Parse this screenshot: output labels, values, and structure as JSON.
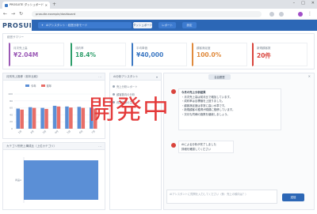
{
  "browser": {
    "tab_title": "PROSUITE ダッシュボード",
    "url": "prosuite.example/dashboard"
  },
  "app": {
    "logo": "PROSUITE",
    "mode_label": "AIアシスタント・経営分析モード",
    "buttons": {
      "primary": "ダッシュボード",
      "secondary": "レポート",
      "menu": "設定"
    }
  },
  "summary": {
    "title": "経営サマリー",
    "kpis": [
      {
        "label": "月次売上高",
        "value": "¥2.04M",
        "color": "#9b59b6"
      },
      {
        "label": "成約率",
        "value": "18.4%",
        "color": "#2e9e6b"
      },
      {
        "label": "平均単価",
        "value": "¥40,000",
        "color": "#3c78c3"
      },
      {
        "label": "顧客満足度",
        "value": "100.0%",
        "color": "#e08a3c"
      },
      {
        "label": "新規顧客数",
        "value": "20件",
        "color": "#d9443c"
      }
    ]
  },
  "left_top": {
    "title": "月別売上推移（前年比較）",
    "legend": [
      {
        "name": "今年",
        "color": "#5b8fd6"
      },
      {
        "name": "前年",
        "color": "#e86e68"
      }
    ]
  },
  "left_bottom": {
    "title": "カテゴリ別売上構成比（上位カテゴリ）",
    "category_label": "商品A"
  },
  "ai_panel": {
    "title": "AI分析アシスタント",
    "rows": [
      "売上分析レポート",
      "顧客動向の分析",
      "改善提案の生成"
    ]
  },
  "chat": {
    "tab": "会話履歴",
    "message_1": [
      "今月の売上分析結果",
      "・月次売上高は前月比で増加しています。",
      "・成約率は目標値を上回りました。",
      "・顧客満足度は非常に高い水準です。",
      "・新規顧客の獲得が順調に推移しています。",
      "・次月も同様の施策を継続しましょう。"
    ],
    "message_2": [
      "AIによる分析が完了しました",
      "詳細を確認してください"
    ],
    "input_placeholder": "AIアシスタントに質問を入力してください（例：売上の傾向は？）",
    "send": "送信"
  },
  "watermark": "開発中",
  "chart_data": [
    {
      "type": "bar",
      "categories": [
        "1月",
        "2月",
        "3月",
        "4月",
        "5月",
        "6月",
        "7月"
      ],
      "series": [
        {
          "name": "今年",
          "values": [
            58,
            62,
            60,
            66,
            64,
            63,
            61
          ]
        },
        {
          "name": "前年",
          "values": [
            55,
            60,
            57,
            64,
            61,
            60,
            58
          ]
        }
      ],
      "ylim": [
        0,
        100
      ],
      "yticks": [
        "0",
        "20",
        "40",
        "60",
        "80",
        "100"
      ]
    },
    {
      "type": "bar",
      "orientation": "horizontal",
      "categories": [
        "商品A"
      ],
      "values": [
        100
      ],
      "xlim": [
        0,
        100
      ]
    }
  ]
}
